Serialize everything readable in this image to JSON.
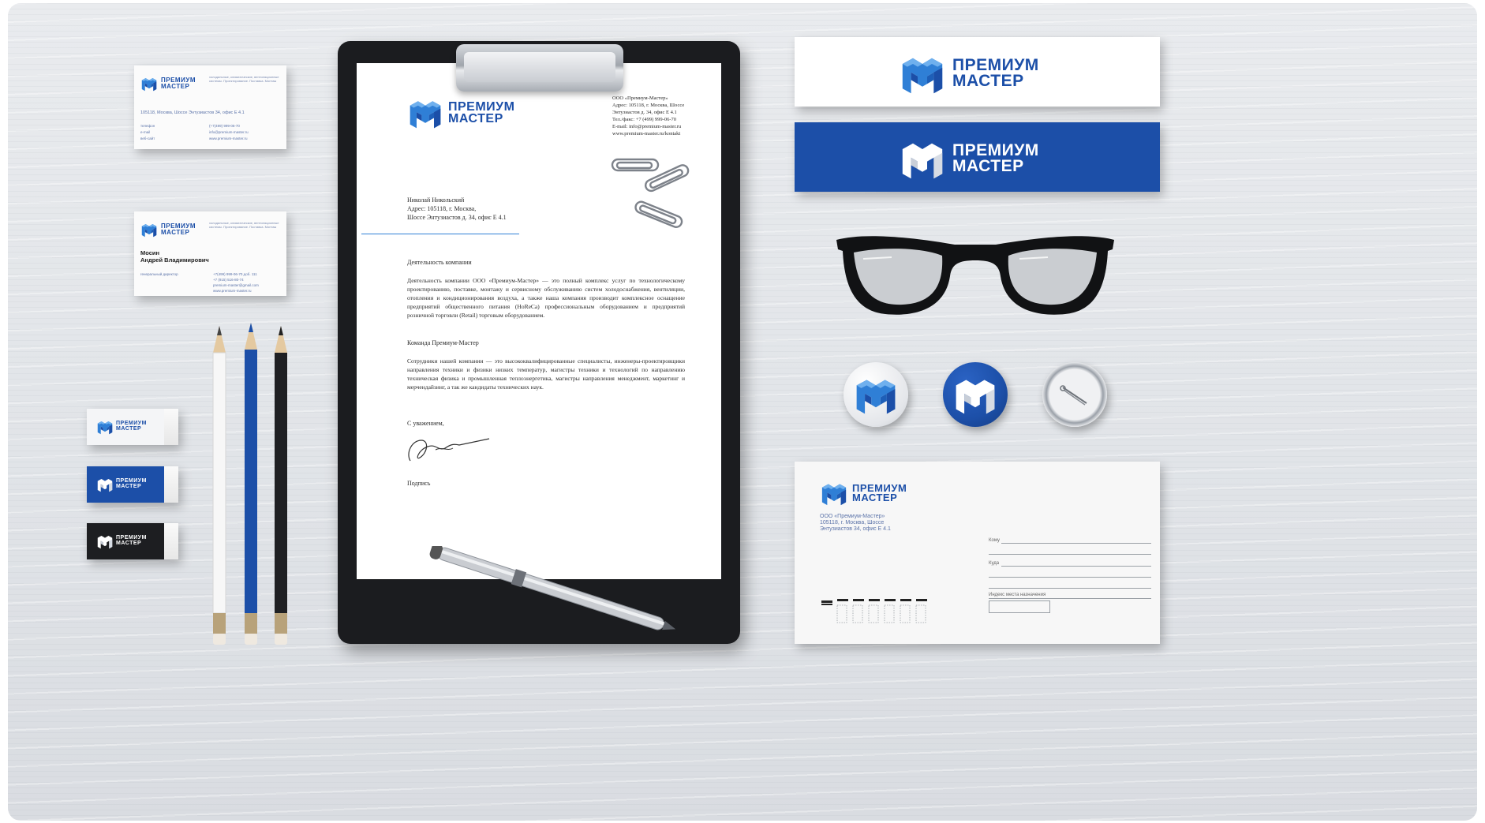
{
  "brand": {
    "line1": "ПРЕМИУМ",
    "line2": "МАСТЕР",
    "colors": {
      "primary_blue": "#1c4fa8",
      "light_blue": "#3b86d8",
      "dark": "#1b1c1f"
    }
  },
  "business_card_1": {
    "tagline": "холодильные, климатические, вентиляционные системы. Проектирование. Поставка. Монтаж",
    "address": "105118, Москва, Шоссе Энтузиастов 34, офис Е 4.1",
    "phone_label": "телефон",
    "email_label": "e-mail",
    "web_label": "веб-сайт",
    "phone": "(+7(499) 999-06-70",
    "email": "info@premium-master.ru",
    "web": "www.premium-master.ru"
  },
  "business_card_2": {
    "tagline": "холодильные, климатические, вентиляционные системы. Проектирование. Поставка. Монтаж",
    "surname": "Мосин",
    "name": "Андрей Владимирович",
    "position": "генеральный директор",
    "phone1": "+7(499) 999-06-70 доб. 111",
    "phone2": "+7 (915) 516-80-74",
    "email": "premium-master@gmail.com",
    "web": "www.premium-master.ru"
  },
  "letter": {
    "company_info": [
      "ООО «Премиум-Мастер»",
      "Адрес: 105118, г. Москва, Шоссе",
      "Энтузиастов д. 34, офис Е 4.1",
      "Тел./факс: +7 (499) 999-06-70",
      "E-mail: info@premium-master.ru",
      "www.premium-master.ru/kontakt"
    ],
    "recipient": [
      "Николай Никольский",
      "Адрес: 105118, г. Москва,",
      "Шоссе Энтузиастов д. 34, офис Е 4.1"
    ],
    "section1_title": "Деятельность компании",
    "section1_body": "Деятельность компании ООО «Премиум-Мастер» — это полный комплекс услуг по технологическому проектированию, поставке, монтажу и сервисному обслуживанию систем холодоснабжения, вентиляции, отопления и кондиционирования воздуха, а также наша компания производит комплексное оснащение предприятий общественного питания (HoReCa) профессиональным оборудованием и предприятий розничной торговли (Retail) торговым оборудованием.",
    "section2_title": "Команда Премиум-Мастер",
    "section2_body": "Сотрудники нашей компании — это высококвалифицированные специалисты, инженеры-проектировщики направления техники и физики низких температур, магистры техники и технологий по направлению техническая физика и промышленная теплоэнергетика, магистры направления менеджмент, маркетинг и мерчендайзинг, а так же кандидаты технических наук.",
    "closing": "С уважением,",
    "signature_label": "Подпись"
  },
  "envelope": {
    "sender": [
      "ООО «Премиум-Мастер»",
      "105118, г. Москва, Шоссе",
      "Энтузиастов 34, офис Е 4.1"
    ],
    "to_label": "Кому",
    "where_label": "Куда",
    "index_label": "Индекс места назначения"
  }
}
